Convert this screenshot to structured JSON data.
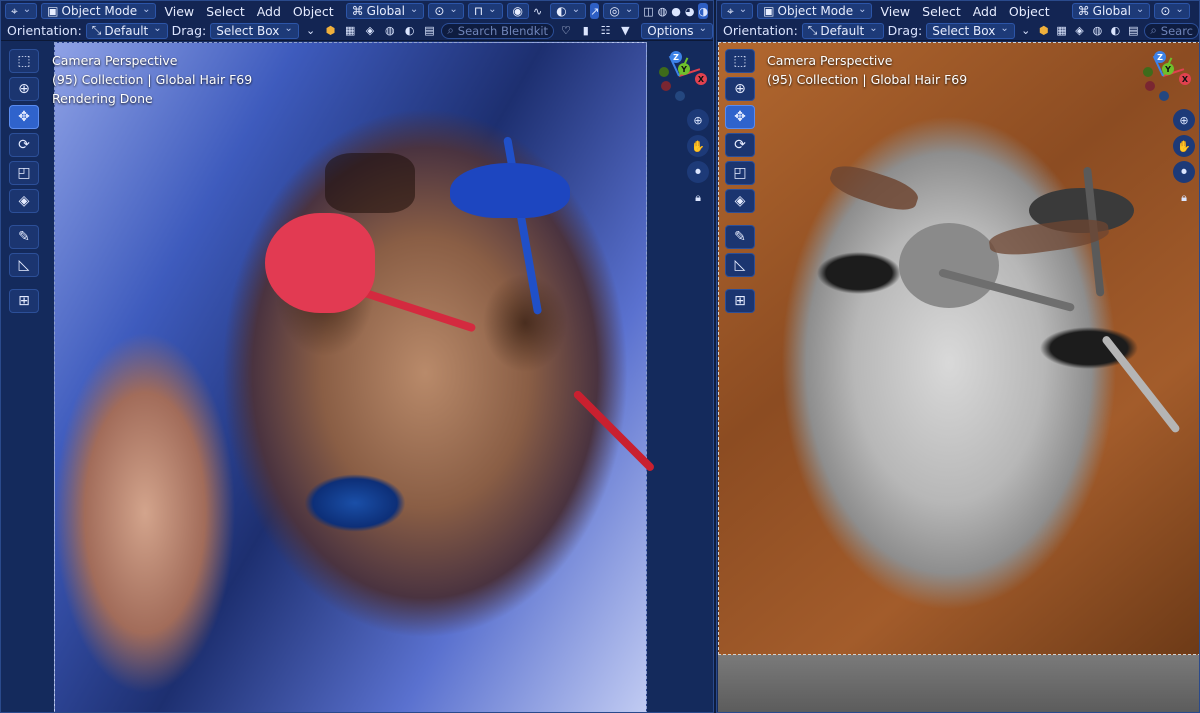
{
  "left_viewport": {
    "header": {
      "editor_icon": "3d-viewport-icon",
      "mode": "Object Mode",
      "menus": [
        "View",
        "Select",
        "Add",
        "Object"
      ],
      "transform_orientation": "Global"
    },
    "tool_header": {
      "orientation_label": "Orientation:",
      "orientation_value": "Default",
      "drag_label": "Drag:",
      "drag_value": "Select Box",
      "search_placeholder": "Search Blendkit",
      "options_label": "Options"
    },
    "overlay": {
      "line1": "Camera Perspective",
      "line2": "(95) Collection | Global Hair F69",
      "line3": "Rendering Done"
    }
  },
  "right_viewport": {
    "header": {
      "editor_icon": "3d-viewport-icon",
      "mode": "Object Mode",
      "menus": [
        "View",
        "Select",
        "Add",
        "Object"
      ],
      "transform_orientation": "Global"
    },
    "tool_header": {
      "orientation_label": "Orientation:",
      "orientation_value": "Default",
      "drag_label": "Drag:",
      "drag_value": "Select Box",
      "search_placeholder": "Searc"
    },
    "overlay": {
      "line1": "Camera Perspective",
      "line2": "(95) Collection | Global Hair F69"
    }
  },
  "gizmo_labels": {
    "x": "X",
    "y": "Y",
    "z": "Z"
  },
  "tools": [
    "select-box-icon",
    "cursor-icon",
    "move-icon",
    "rotate-icon",
    "scale-icon",
    "transform-icon",
    "annotate-icon",
    "measure-icon",
    "add-cube-icon"
  ],
  "colors": {
    "ui_background": "#142a5c",
    "header": "#132553",
    "accent": "#2f63cc",
    "axis_x": "#e0414f",
    "axis_y": "#6ec02c",
    "axis_z": "#3d82e8"
  }
}
